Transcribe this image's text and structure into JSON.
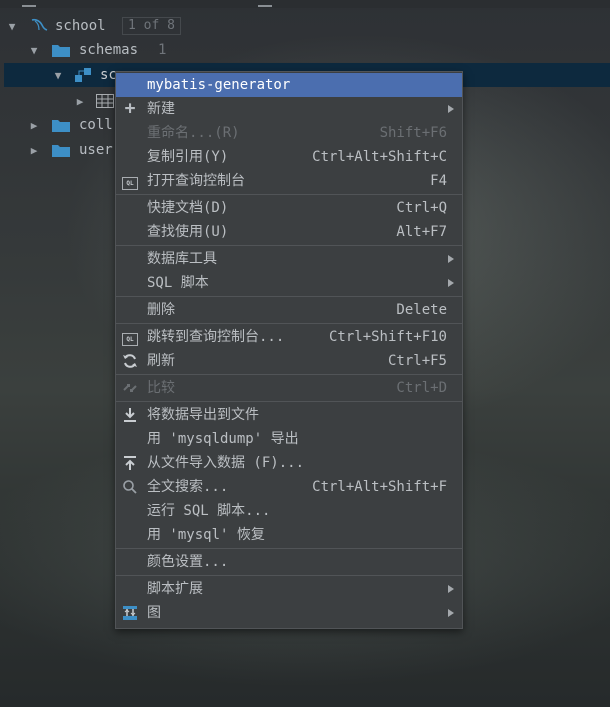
{
  "tree": {
    "root": {
      "label": "school",
      "pager": "1 of 8"
    },
    "schemas": {
      "label": "schemas",
      "count": "1"
    },
    "schema_item": {
      "label": "sc"
    },
    "collations": {
      "label": "coll"
    },
    "users": {
      "label": "user"
    }
  },
  "menu": {
    "items": [
      {
        "label": "mybatis-generator",
        "shortcut": ""
      },
      {
        "label": "新建",
        "shortcut": ""
      },
      {
        "label": "重命名...(R)",
        "shortcut": "Shift+F6"
      },
      {
        "label": "复制引用(Y)",
        "shortcut": "Ctrl+Alt+Shift+C"
      },
      {
        "label": "打开查询控制台",
        "shortcut": "F4"
      },
      {
        "label": "快捷文档(D)",
        "shortcut": "Ctrl+Q"
      },
      {
        "label": "查找使用(U)",
        "shortcut": "Alt+F7"
      },
      {
        "label": "数据库工具",
        "shortcut": ""
      },
      {
        "label": "SQL 脚本",
        "shortcut": ""
      },
      {
        "label": "删除",
        "shortcut": "Delete"
      },
      {
        "label": "跳转到查询控制台...",
        "shortcut": "Ctrl+Shift+F10"
      },
      {
        "label": "刷新",
        "shortcut": "Ctrl+F5"
      },
      {
        "label": "比较",
        "shortcut": "Ctrl+D"
      },
      {
        "label": "将数据导出到文件",
        "shortcut": ""
      },
      {
        "label": "用 'mysqldump' 导出",
        "shortcut": ""
      },
      {
        "label": "从文件导入数据 (F)...",
        "shortcut": ""
      },
      {
        "label": "全文搜索...",
        "shortcut": "Ctrl+Alt+Shift+F"
      },
      {
        "label": "运行 SQL 脚本...",
        "shortcut": ""
      },
      {
        "label": "用 'mysql' 恢复",
        "shortcut": ""
      },
      {
        "label": "颜色设置...",
        "shortcut": ""
      },
      {
        "label": "脚本扩展",
        "shortcut": ""
      },
      {
        "label": "图",
        "shortcut": ""
      }
    ],
    "ql_icon_text": "QL"
  },
  "colors": {
    "highlight": "#4b6eaf",
    "menu_bg": "#3c3f41",
    "folder": "#3d8fc6",
    "selected_row": "#0d293e"
  }
}
